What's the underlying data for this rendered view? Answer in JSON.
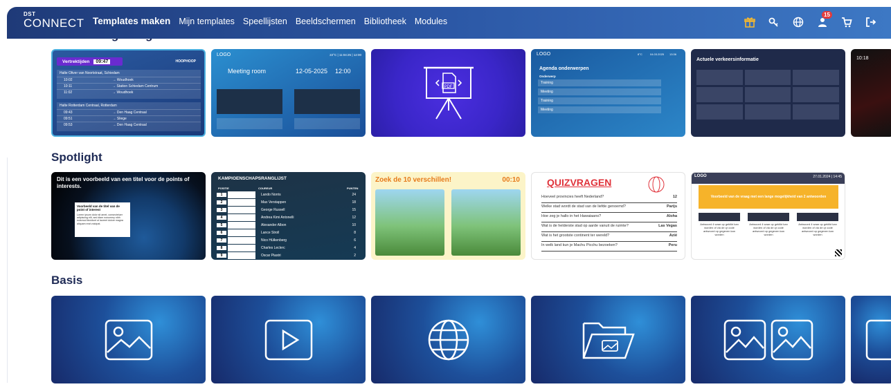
{
  "brand": {
    "small": "DST",
    "name": "CONNECT"
  },
  "nav": [
    {
      "label": "Templates maken",
      "active": true
    },
    {
      "label": "Mijn templates"
    },
    {
      "label": "Speellijsten"
    },
    {
      "label": "Beeldschermen"
    },
    {
      "label": "Bibliotheek"
    },
    {
      "label": "Modules"
    }
  ],
  "header_icons": [
    "gift-icon",
    "key-icon",
    "globe-icon",
    "user-icon",
    "cart-icon",
    "logout-icon"
  ],
  "notifications": "15",
  "sections": {
    "recent": "Recent toegevoegd",
    "spotlight": "Spotlight",
    "basis": "Basis"
  },
  "recent_cards": {
    "departures": {
      "title": "Vertrektijden",
      "time": "09:47",
      "brand": "HOOPHOOP",
      "group1": "Halte Oliver van Noortstraat, Schiedam",
      "rows1": [
        [
          "10:02",
          "→ Woudhoek"
        ],
        [
          "10:11",
          "→ Station Schiedam Centrum"
        ],
        [
          "11:02",
          "→ Woudhoek"
        ]
      ],
      "group2": "Halte Rotterdam Centraal, Rotterdam",
      "rows2": [
        [
          "09:43",
          "→ Den Haag Centraal"
        ],
        [
          "09:51",
          "→ Sliege"
        ],
        [
          "09:53",
          "→ Den Haag Centraal"
        ]
      ]
    },
    "meeting": {
      "logo": "LOGO",
      "status": "22°C | 11:04:25 | 12:00",
      "title": "Meeting room",
      "date": "12-05-2025",
      "time": "12:00"
    },
    "agenda": {
      "logo": "LOGO",
      "weather": "8°C",
      "date": "04.03.2025",
      "clock": "13:36",
      "title": "Agenda onderwerpen",
      "sub": "Onderwerp",
      "items": [
        "Training",
        "Meeting",
        "Training",
        "Meeting"
      ]
    },
    "traffic": {
      "title": "Actuele verkeersinformatie"
    },
    "partial_time": "10:18",
    "pdf_label": "PDF"
  },
  "spotlight_cards": {
    "points": {
      "title": "Dit is een voorbeeld van een titel voor de points of interests.",
      "box_title": "Voorbeeld van de titel van de point of interest",
      "box_text": "Lorem ipsum dolor sit amet, consectetuer adipiscing elit, sed diam nonummy nibh euismod tincidunt ut laoreet dolore magna aliquam erat volutpat."
    },
    "ranking": {
      "title": "KAMPIOENSCHAPSRANGLIJST",
      "col_pos": "POSITIE",
      "col_driver": "COUREUR",
      "col_points": "PUNTEN",
      "rows": [
        [
          "1",
          "Lando Norris",
          "24"
        ],
        [
          "2",
          "Max Verstappen",
          "18"
        ],
        [
          "3",
          "George Russell",
          "15"
        ],
        [
          "4",
          "Andrea Kimi Antonelli",
          "12"
        ],
        [
          "5",
          "Alexander Albon",
          "10"
        ],
        [
          "6",
          "Lance Stroll",
          "8"
        ],
        [
          "7",
          "Nico Hülkenberg",
          "6"
        ],
        [
          "8",
          "Charles Leclerc",
          "4"
        ],
        [
          "9",
          "Oscar Piastri",
          "2"
        ]
      ]
    },
    "diff": {
      "title": "Zoek de 10 verschillen!",
      "timer": "00:10"
    },
    "quiz": {
      "title": "QUIZVRAGEN",
      "items": [
        [
          "Hoeveel provincies heeft Nederland?",
          "12"
        ],
        [
          "Welke stad wordt de stad van de liefde genoemd?",
          "Parijs"
        ],
        [
          "Hoe zeg je hallo in het Hawaiaans?",
          "Aloha"
        ],
        [
          "Wat is de helderste stad op aarde vanuit de ruimte?",
          "Las Vegas"
        ],
        [
          "Wat is het grootste continent ter wereld?",
          "Azië"
        ],
        [
          "In welk land kun je Machu Picchu bezoeken?",
          "Peru"
        ]
      ]
    },
    "qa": {
      "logo": "LOGO",
      "date": "27.01.2024 | 14:45",
      "banner": "Voorbeeld van de vraag met een lange mogelijkheid van 2 antwoorden",
      "answer": "Antwoord 4 waar op geklikt kan worden of via de qr code antwoord op gegeven kan worden"
    }
  },
  "basis_cards": [
    "image-icon",
    "play-icon",
    "web-icon",
    "media-folder-icon",
    "two-images-icon",
    "partial"
  ]
}
